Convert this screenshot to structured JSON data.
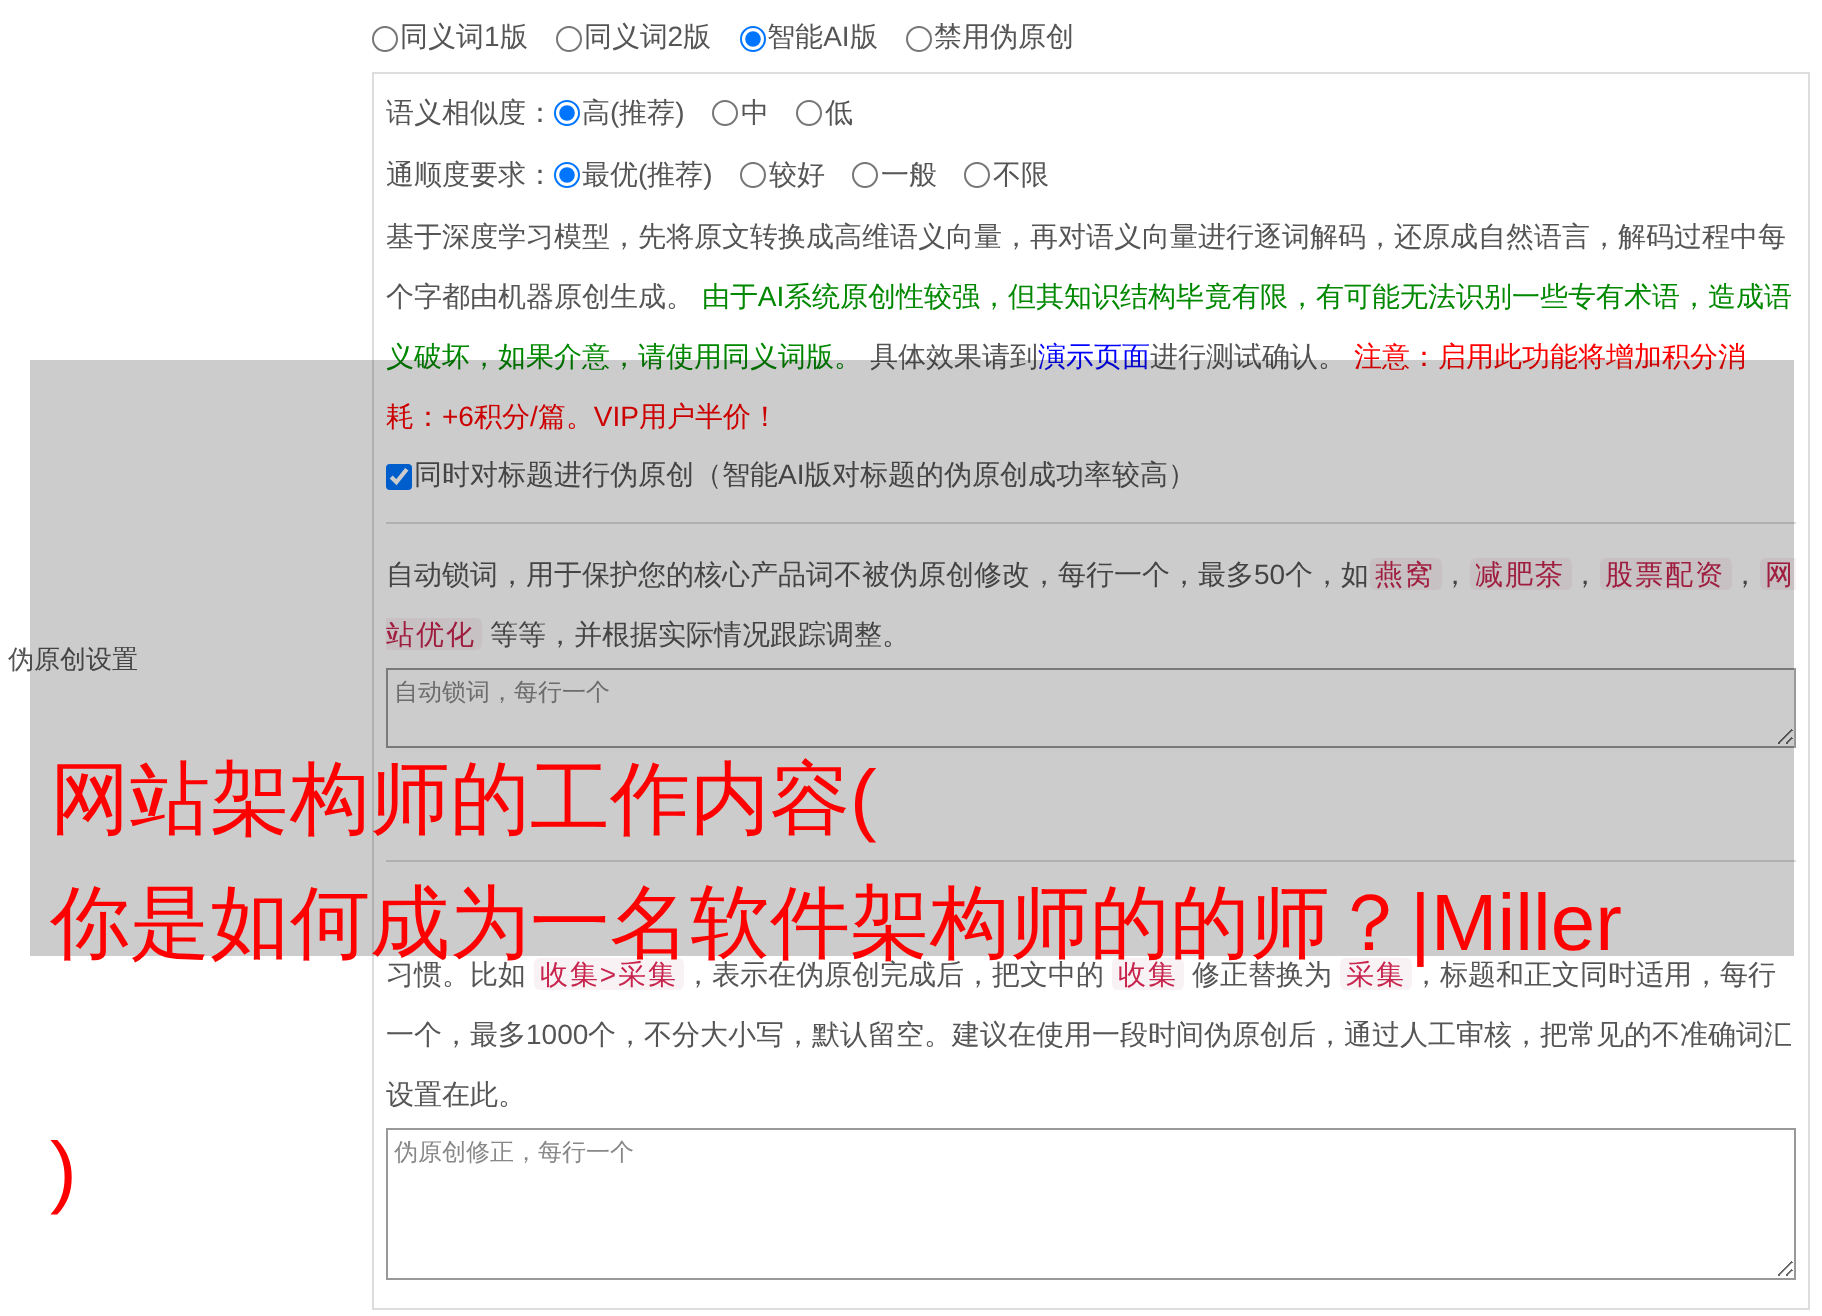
{
  "side_label": "伪原创设置",
  "modes": [
    {
      "label": "同义词1版",
      "selected": false
    },
    {
      "label": "同义词2版",
      "selected": false
    },
    {
      "label": "智能AI版",
      "selected": true
    },
    {
      "label": "禁用伪原创",
      "selected": false
    }
  ],
  "options": [
    {
      "label": "语义相似度：",
      "choices": [
        {
          "label": "高(推荐)",
          "selected": true
        },
        {
          "label": "中",
          "selected": false
        },
        {
          "label": "低",
          "selected": false
        }
      ]
    },
    {
      "label": "通顺度要求：",
      "choices": [
        {
          "label": "最优(推荐)",
          "selected": true
        },
        {
          "label": "较好",
          "selected": false
        },
        {
          "label": "一般",
          "selected": false
        },
        {
          "label": "不限",
          "selected": false
        }
      ]
    }
  ],
  "description": [
    {
      "kind": "text",
      "text": "基于深度学习模型，先将原文转换成高维语义向量，再对语义向量进行逐词解码，还原成自然语言，解码过程中每个字都由机器原创生成。 "
    },
    {
      "kind": "green",
      "text": "由于AI系统原创性较强，但其知识结构毕竟有限，有可能无法识别一些专有术语，造成语义破坏，如果介意，请使用同义词版。"
    },
    {
      "kind": "text",
      "text": " 具体效果请到"
    },
    {
      "kind": "link",
      "text": "演示页面"
    },
    {
      "kind": "text",
      "text": "进行测试确认。 "
    },
    {
      "kind": "red",
      "text": "注意：启用此功能将增加积分消耗：+6积分/篇。VIP用户半价！"
    }
  ],
  "title_option": {
    "label": "同时对标题进行伪原创（智能AI版对标题的伪原创成功率较高）",
    "checked": true
  },
  "lock_words": {
    "help": [
      {
        "kind": "text",
        "text": "自动锁词，用于保护您的核心产品词不被伪原创修改，每行一个，最多50个，如"
      },
      {
        "kind": "tag",
        "text": "燕窝"
      },
      {
        "kind": "text",
        "text": "，"
      },
      {
        "kind": "tag",
        "text": "减肥茶"
      },
      {
        "kind": "text",
        "text": "，"
      },
      {
        "kind": "tag",
        "text": "股票配资"
      },
      {
        "kind": "text",
        "text": "，"
      },
      {
        "kind": "tag",
        "text": "网站优化"
      },
      {
        "kind": "text",
        "text": " 等等，并根据实际情况跟踪调整。"
      }
    ],
    "placeholder": "自动锁词，每行一个"
  },
  "corrections": {
    "help": [
      {
        "kind": "text",
        "text": "习惯。比如 "
      },
      {
        "kind": "tag",
        "text": "收集>采集"
      },
      {
        "kind": "text",
        "text": "，表示在伪原创完成后，把文中的 "
      },
      {
        "kind": "tag",
        "text": "收集"
      },
      {
        "kind": "text",
        "text": " 修正替换为 "
      },
      {
        "kind": "tag",
        "text": "采集"
      },
      {
        "kind": "text",
        "text": "，标题和正文同时适用，每行一个，最多1000个，不分大小写，默认留空。建议在使用一段时间伪原创后，通过人工审核，把常见的不准确词汇设置在此。"
      }
    ],
    "placeholder": "伪原创修正，每行一个"
  },
  "overlay_caption": [
    "网站架构师的工作内容(",
    "你是如何成为一名软件架构师的的师？|Miller",
    ")"
  ]
}
